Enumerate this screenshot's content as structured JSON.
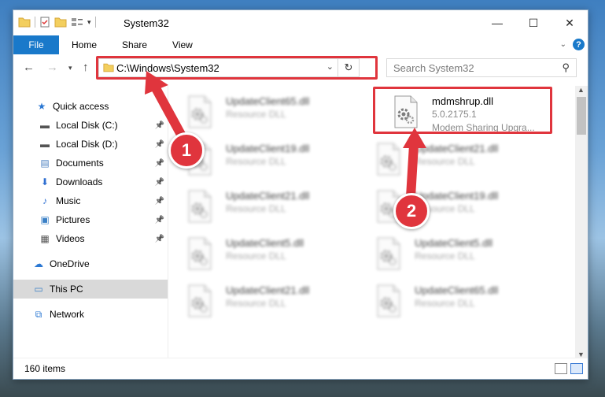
{
  "window": {
    "title": "System32",
    "controls": [
      "—",
      "☐",
      "✕"
    ]
  },
  "ribbon": {
    "tabs": [
      "File",
      "Home",
      "Share",
      "View"
    ]
  },
  "navbar": {
    "address": "C:\\Windows\\System32",
    "search_placeholder": "Search System32"
  },
  "sidebar": {
    "items": [
      {
        "label": "Quick access",
        "icon": "star-icon",
        "pinned": false
      },
      {
        "label": "Local Disk (C:)",
        "icon": "drive-icon",
        "pinned": true
      },
      {
        "label": "Local Disk (D:)",
        "icon": "drive-icon",
        "pinned": true
      },
      {
        "label": "Documents",
        "icon": "documents-icon",
        "pinned": true
      },
      {
        "label": "Downloads",
        "icon": "download-icon",
        "pinned": true
      },
      {
        "label": "Music",
        "icon": "music-icon",
        "pinned": true
      },
      {
        "label": "Pictures",
        "icon": "pictures-icon",
        "pinned": true
      },
      {
        "label": "Videos",
        "icon": "videos-icon",
        "pinned": true
      },
      {
        "label": "OneDrive",
        "icon": "cloud-icon",
        "pinned": false
      },
      {
        "label": "This PC",
        "icon": "computer-icon",
        "pinned": false,
        "selected": true
      },
      {
        "label": "Network",
        "icon": "network-icon",
        "pinned": false
      }
    ]
  },
  "files": {
    "highlighted": {
      "name": "mdmshrup.dll",
      "version": "5.0.2175.1",
      "description": "Modem Sharing Upgra..."
    },
    "left": [
      {
        "name": "UpdateClient65.dll",
        "type": "Resource DLL"
      },
      {
        "name": "UpdateClient19.dll",
        "type": "Resource DLL"
      },
      {
        "name": "UpdateClient21.dll",
        "type": "Resource DLL"
      },
      {
        "name": "UpdateClient5.dll",
        "type": "Resource DLL"
      },
      {
        "name": "UpdateClient21.dll",
        "type": "Resource DLL"
      }
    ],
    "right": [
      {
        "name": "UpdateClient21.dll",
        "type": "Resource DLL"
      },
      {
        "name": "UpdateClient19.dll",
        "type": "Resource DLL"
      },
      {
        "name": "UpdateClient5.dll",
        "type": "Resource DLL"
      },
      {
        "name": "UpdateClient65.dll",
        "type": "Resource DLL"
      }
    ]
  },
  "status": {
    "count": "160 items"
  },
  "annotations": {
    "badge1": "1",
    "badge2": "2",
    "color": "#e0353d"
  }
}
